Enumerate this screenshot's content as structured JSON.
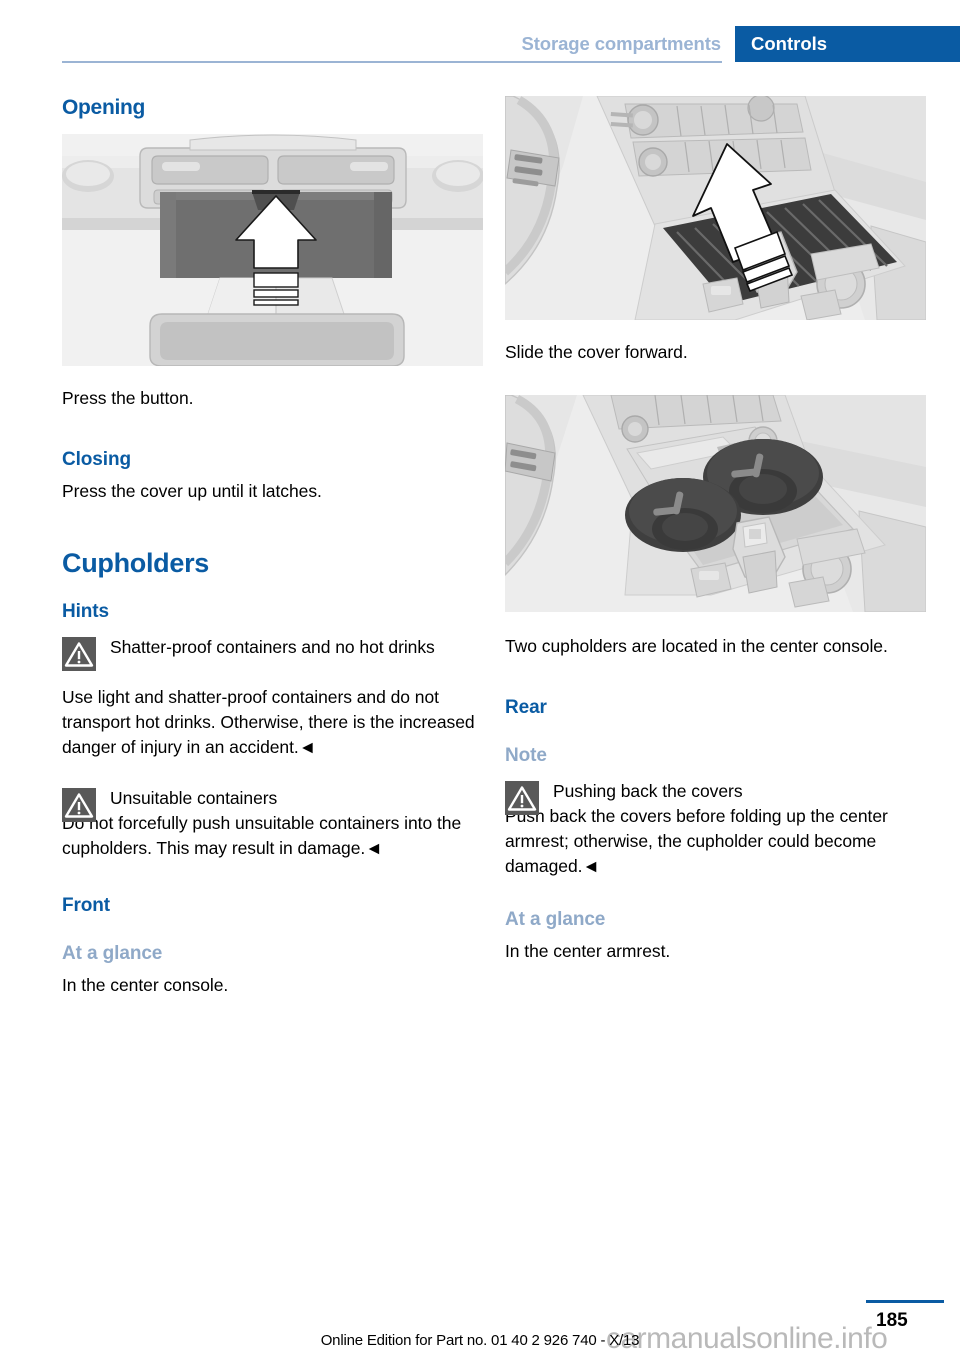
{
  "header": {
    "chapter": "Storage compartments",
    "section": "Controls"
  },
  "left_column": {
    "opening_heading": "Opening",
    "figure_overhead_caption": "Press the button.",
    "closing_heading": "Closing",
    "closing_text": "Press the cover up until it latches.",
    "cupholders_title": "Cupholders",
    "hints_heading": "Hints",
    "warning_1": {
      "icon": "warning-triangle-icon",
      "title": "Shatter-proof containers and no hot drinks",
      "body": "Use light and shatter-proof containers and do not transport hot drinks. Otherwise, there is the increased danger of injury in an accident.◄"
    },
    "warning_2": {
      "icon": "warning-triangle-icon",
      "title": "Unsuitable containers",
      "body": "Do not forcefully push unsuitable containers into the cupholders. This may result in damage.◄"
    },
    "front_heading": "Front",
    "at_a_glance_heading": "At a glance",
    "at_a_glance_text": "In the center console."
  },
  "right_column": {
    "figure_slide_caption": "Slide the cover forward.",
    "figure_cupholders_caption": "Two cupholders are located in the center console.",
    "rear_heading": "Rear",
    "note_heading": "Note",
    "warning_3": {
      "icon": "warning-triangle-icon",
      "title": "Pushing back the covers",
      "body": "Push back the covers before folding up the center armrest; otherwise, the cupholder could become damaged.◄"
    },
    "at_a_glance_heading": "At a glance",
    "at_a_glance_text": "In the center armrest."
  },
  "footer": {
    "page_number": "185",
    "edition_text": "Online Edition for Part no. 01 40 2 926 740 - X/13",
    "watermark": "carmanualsonline.info"
  },
  "colors": {
    "brand_blue": "#0a5ba3",
    "muted_blue": "#8fa9c8",
    "header_chapter_blue": "#9bb4d4",
    "warning_icon_gray": "#595959",
    "figure_background": "#f1f1f1"
  }
}
